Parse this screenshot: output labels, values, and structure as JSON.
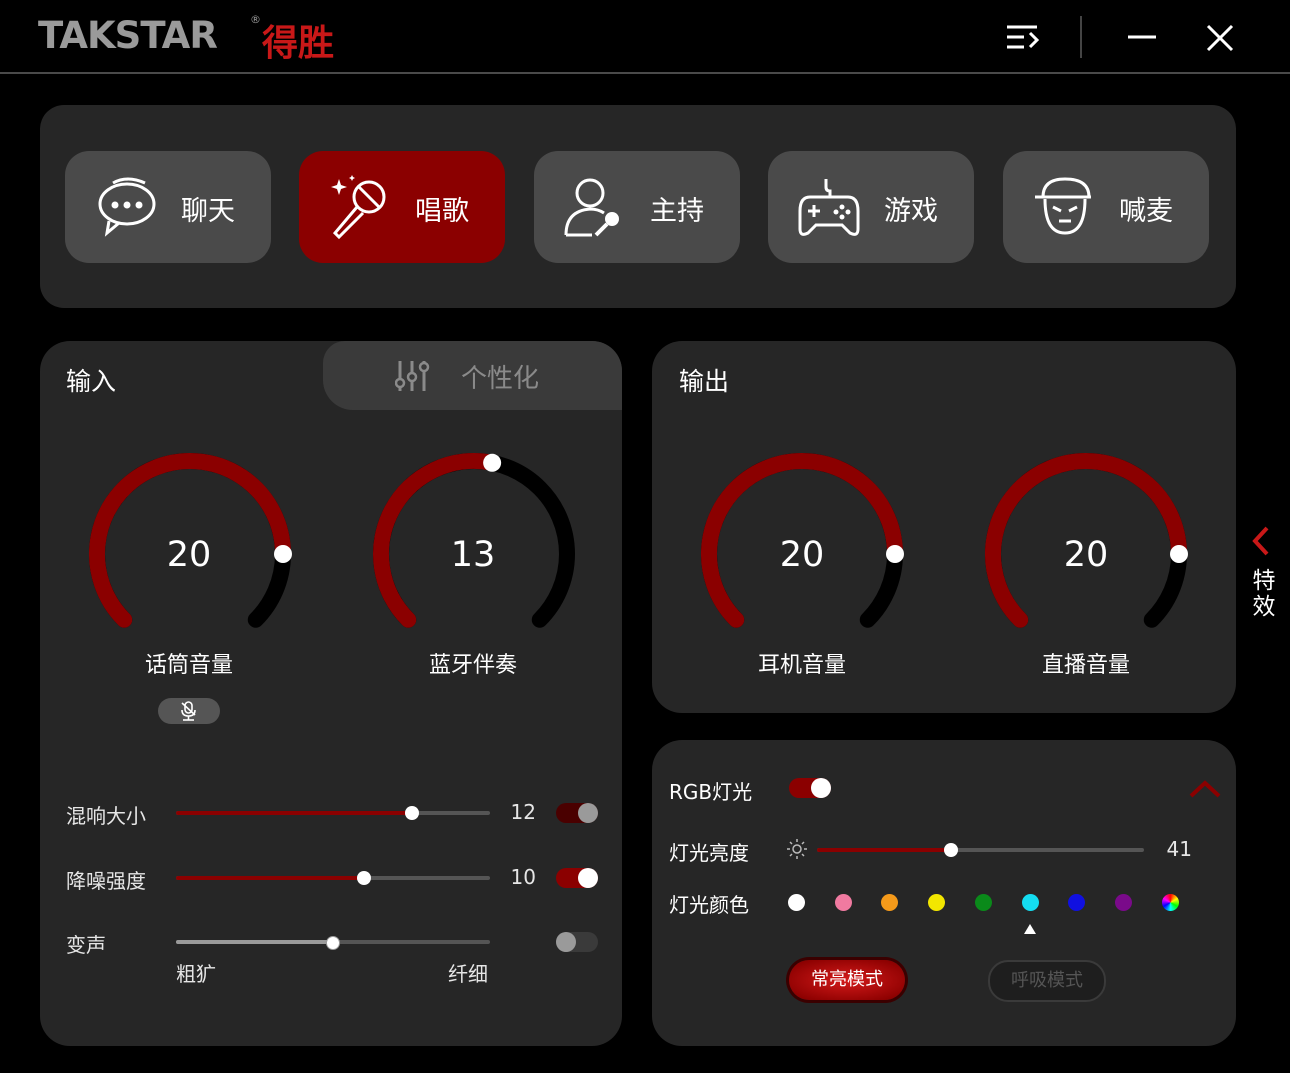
{
  "brand": {
    "latin": "TAKSTAR",
    "reg": "®",
    "cn": "得胜"
  },
  "titlebar": {
    "menu_icon": "menu-icon",
    "min_icon": "minimize-icon",
    "close_icon": "close-icon"
  },
  "modes": [
    {
      "label": "聊天",
      "icon": "chat-icon",
      "active": false
    },
    {
      "label": "唱歌",
      "icon": "microphone-icon",
      "active": true
    },
    {
      "label": "主持",
      "icon": "host-icon",
      "active": false
    },
    {
      "label": "游戏",
      "icon": "gamepad-icon",
      "active": false
    },
    {
      "label": "喊麦",
      "icon": "shout-icon",
      "active": false
    }
  ],
  "input": {
    "title": "输入",
    "tab_personalize": "个性化",
    "knobs": [
      {
        "label": "话筒音量",
        "value": 20
      },
      {
        "label": "蓝牙伴奏",
        "value": 13
      }
    ],
    "sliders": [
      {
        "label": "混响大小",
        "value": 12,
        "fraction": 0.75,
        "enabled": false
      },
      {
        "label": "降噪强度",
        "value": 10,
        "fraction": 0.6,
        "enabled": true
      }
    ],
    "voice_change": {
      "label": "变声",
      "min_label": "粗犷",
      "max_label": "纤细",
      "fraction": 0.5,
      "enabled": false
    }
  },
  "output": {
    "title": "输出",
    "knobs": [
      {
        "label": "耳机音量",
        "value": 20
      },
      {
        "label": "直播音量",
        "value": 20
      }
    ]
  },
  "effects_tab": {
    "label_1": "特",
    "label_2": "效"
  },
  "rgb": {
    "title": "RGB灯光",
    "enabled": true,
    "brightness_label": "灯光亮度",
    "brightness": 41,
    "brightness_fraction": 0.41,
    "color_label": "灯光颜色",
    "colors": [
      "#ffffff",
      "#f07aa0",
      "#f59a1a",
      "#f2e600",
      "#0a8a1a",
      "#14dcf0",
      "#1010e0",
      "#7a0a8a",
      "rainbow"
    ],
    "selected_color": 5,
    "mode_steady": "常亮模式",
    "mode_breath": "呼吸模式"
  }
}
